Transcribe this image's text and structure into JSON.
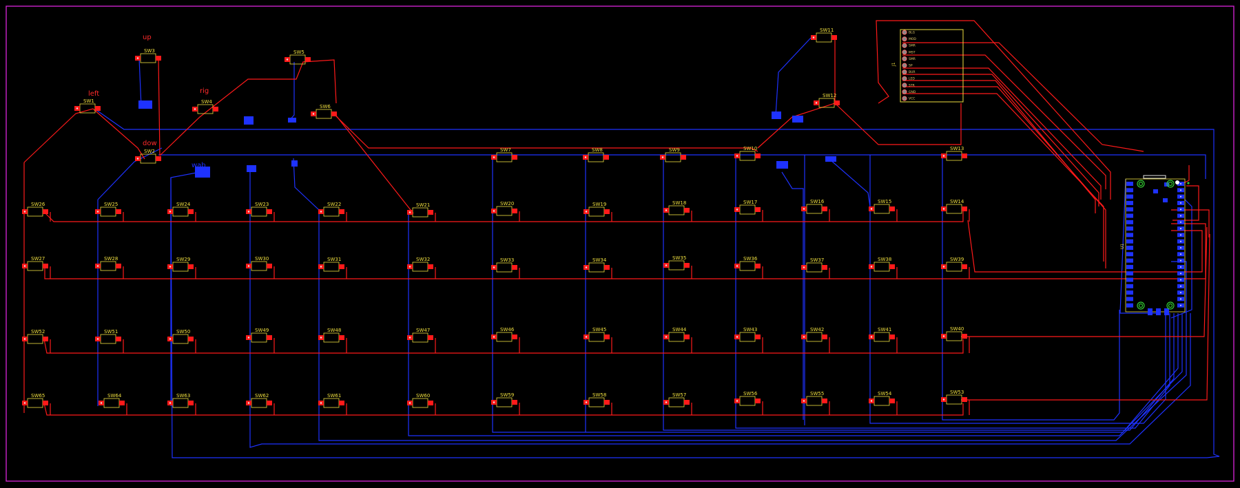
{
  "colors": {
    "background": "#000000",
    "board_outline": "#cc22cc",
    "top_copper": "#ff1a1a",
    "bottom_copper": "#1e32ff",
    "silkscreen": "#f0e040",
    "via_ring": "#33cc33"
  },
  "labels": {
    "up": "up",
    "left": "left",
    "rig": "rig",
    "dow": "dow",
    "wab": "wab",
    "sw_prefix": "SW",
    "controller": "U1",
    "header": "J1"
  },
  "header_pins": [
    "BLG",
    "MOD",
    "SMR",
    "MST",
    "SMR",
    "SP",
    "BUR",
    "LED",
    "STR",
    "GND",
    "VCC"
  ],
  "switches": [
    {
      "n": 1
    },
    {
      "n": 2
    },
    {
      "n": 3
    },
    {
      "n": 4
    },
    {
      "n": 5
    },
    {
      "n": 6
    },
    {
      "n": 7
    },
    {
      "n": 8
    },
    {
      "n": 9
    },
    {
      "n": 10
    },
    {
      "n": 11
    },
    {
      "n": 12
    },
    {
      "n": 13
    },
    {
      "n": 14
    },
    {
      "n": 15
    },
    {
      "n": 16
    },
    {
      "n": 17
    },
    {
      "n": 18
    },
    {
      "n": 19
    },
    {
      "n": 20
    },
    {
      "n": 21
    },
    {
      "n": 22
    },
    {
      "n": 23
    },
    {
      "n": 24
    },
    {
      "n": 25
    },
    {
      "n": 26
    },
    {
      "n": 27
    },
    {
      "n": 28
    },
    {
      "n": 29
    },
    {
      "n": 30
    },
    {
      "n": 31
    },
    {
      "n": 32
    },
    {
      "n": 33
    },
    {
      "n": 34
    },
    {
      "n": 35
    },
    {
      "n": 36
    },
    {
      "n": 37
    },
    {
      "n": 38
    },
    {
      "n": 39
    },
    {
      "n": 40
    },
    {
      "n": 41
    },
    {
      "n": 42
    },
    {
      "n": 43
    },
    {
      "n": 44
    },
    {
      "n": 45
    },
    {
      "n": 46
    },
    {
      "n": 47
    },
    {
      "n": 48
    },
    {
      "n": 49
    },
    {
      "n": 50
    },
    {
      "n": 51
    },
    {
      "n": 52
    },
    {
      "n": 53
    },
    {
      "n": 54
    },
    {
      "n": 55
    },
    {
      "n": 56
    },
    {
      "n": 57
    },
    {
      "n": 58
    },
    {
      "n": 59
    },
    {
      "n": 60
    },
    {
      "n": 61
    },
    {
      "n": 62
    },
    {
      "n": 63
    },
    {
      "n": 64
    },
    {
      "n": 65
    }
  ]
}
